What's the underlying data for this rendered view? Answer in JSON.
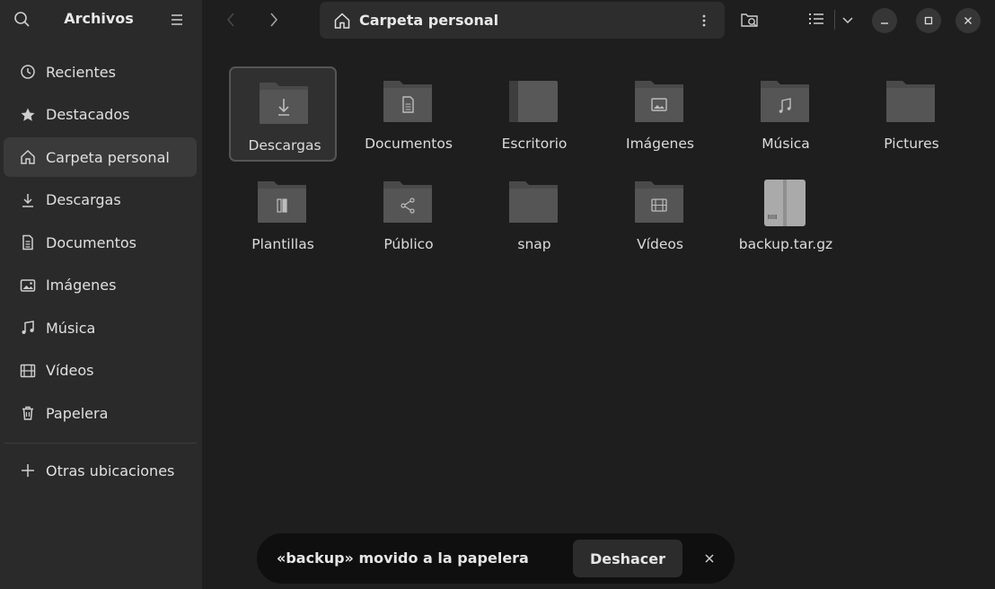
{
  "sidebar": {
    "title": "Archivos",
    "items": [
      {
        "label": "Recientes",
        "icon": "clock-icon"
      },
      {
        "label": "Destacados",
        "icon": "star-icon"
      },
      {
        "label": "Carpeta personal",
        "icon": "home-icon",
        "active": true
      },
      {
        "label": "Descargas",
        "icon": "download-icon"
      },
      {
        "label": "Documentos",
        "icon": "document-icon"
      },
      {
        "label": "Imágenes",
        "icon": "image-icon"
      },
      {
        "label": "Música",
        "icon": "music-icon"
      },
      {
        "label": "Vídeos",
        "icon": "film-icon"
      },
      {
        "label": "Papelera",
        "icon": "trash-icon"
      }
    ],
    "other_locations": "Otras ubicaciones"
  },
  "header": {
    "path": "Carpeta personal"
  },
  "files": [
    {
      "name": "Descargas",
      "emblem": "download-icon",
      "selected": true
    },
    {
      "name": "Documentos",
      "emblem": "document-icon"
    },
    {
      "name": "Escritorio",
      "emblem": "desktop-folder-icon"
    },
    {
      "name": "Imágenes",
      "emblem": "image-icon"
    },
    {
      "name": "Música",
      "emblem": "music-icon"
    },
    {
      "name": "Pictures",
      "emblem": "none"
    },
    {
      "name": "Plantillas",
      "emblem": "template-icon"
    },
    {
      "name": "Público",
      "emblem": "share-icon"
    },
    {
      "name": "snap",
      "emblem": "none"
    },
    {
      "name": "Vídeos",
      "emblem": "film-icon"
    },
    {
      "name": "backup.tar.gz",
      "emblem": "archive-icon"
    }
  ],
  "toast": {
    "message": "«backup» movido a la papelera",
    "undo_label": "Deshacer"
  },
  "colors": {
    "window_bg": "#1e1e1e",
    "sidebar_bg": "#2a2a2a",
    "folder": "#4a4a4a",
    "toast_bg": "#0f0f0f"
  }
}
